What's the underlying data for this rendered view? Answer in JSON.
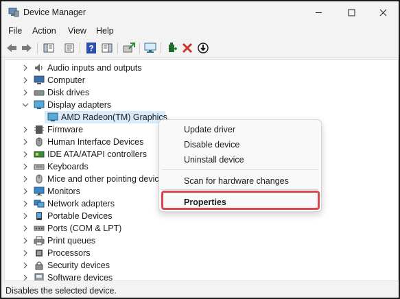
{
  "window": {
    "title": "Device Manager"
  },
  "menu": [
    "File",
    "Action",
    "View",
    "Help"
  ],
  "toolbar_icons": [
    "back-icon",
    "forward-icon",
    "show-hide-console-tree-icon",
    "properties-icon",
    "help-icon",
    "action-pane-icon",
    "update-driver-icon",
    "scan-hardware-icon",
    "add-legacy-hardware-icon",
    "uninstall-device-icon",
    "disable-device-icon"
  ],
  "tree": {
    "items": [
      {
        "label": "Audio inputs and outputs",
        "icon": "speaker-icon",
        "expanded": false
      },
      {
        "label": "Computer",
        "icon": "computer-icon",
        "expanded": false
      },
      {
        "label": "Disk drives",
        "icon": "disk-drive-icon",
        "expanded": false
      },
      {
        "label": "Display adapters",
        "icon": "display-adapter-icon",
        "expanded": true
      },
      {
        "label": "AMD Radeon(TM) Graphics",
        "icon": "display-adapter-icon",
        "child": true,
        "selected": true
      },
      {
        "label": "Firmware",
        "icon": "firmware-icon",
        "expanded": false
      },
      {
        "label": "Human Interface Devices",
        "icon": "hid-icon",
        "expanded": false
      },
      {
        "label": "IDE ATA/ATAPI controllers",
        "icon": "ide-controller-icon",
        "expanded": false
      },
      {
        "label": "Keyboards",
        "icon": "keyboard-icon",
        "expanded": false
      },
      {
        "label": "Mice and other pointing devices",
        "icon": "mouse-icon",
        "expanded": false
      },
      {
        "label": "Monitors",
        "icon": "monitor-icon",
        "expanded": false
      },
      {
        "label": "Network adapters",
        "icon": "network-adapter-icon",
        "expanded": false
      },
      {
        "label": "Portable Devices",
        "icon": "portable-device-icon",
        "expanded": false
      },
      {
        "label": "Ports (COM & LPT)",
        "icon": "port-icon",
        "expanded": false
      },
      {
        "label": "Print queues",
        "icon": "printer-icon",
        "expanded": false
      },
      {
        "label": "Processors",
        "icon": "processor-icon",
        "expanded": false
      },
      {
        "label": "Security devices",
        "icon": "security-device-icon",
        "expanded": false
      },
      {
        "label": "Software devices",
        "icon": "software-device-icon",
        "expanded": false
      }
    ]
  },
  "context_menu": {
    "items": [
      "Update driver",
      "Disable device",
      "Uninstall device",
      "Scan for hardware changes",
      "Properties"
    ],
    "highlight_color": "#d9454d"
  },
  "status": {
    "text": "Disables the selected device."
  }
}
